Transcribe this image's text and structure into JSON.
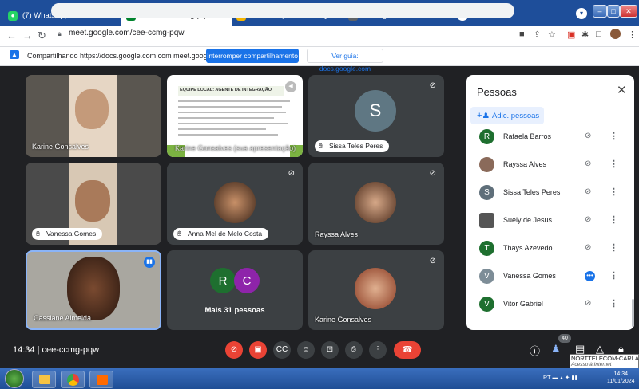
{
  "browser": {
    "tabs": [
      {
        "label": "(7) WhatsApp",
        "icon": "whatsapp-icon",
        "color": "#25d366",
        "close": "✕"
      },
      {
        "label": "Meet: cee-ccmg-pqw",
        "icon": "meet-icon",
        "color": "#00832d",
        "close": "✕",
        "active": true
      },
      {
        "label": "ATRIBUIÇÕES DE EQUIPE_CI",
        "icon": "slides-icon",
        "color": "#f4b400",
        "close": "✕"
      },
      {
        "label": "Nova guia",
        "icon": "chrome-icon",
        "color": "#5f6368",
        "close": "✕"
      }
    ],
    "new_tab": "+",
    "url": "meet.google.com/cee-ccmg-pqw"
  },
  "share_bar": {
    "text": "Compartilhando https://docs.google.com com meet.google.com",
    "stop_label": "Interromper compartilhamento",
    "guide_label": "Ver guia: docs.google.com"
  },
  "tiles": [
    {
      "name": "Karine Gonsalves"
    },
    {
      "name": "Karine Gonsalves (sua apresentação)",
      "slide_title": "EQUIPE LOCAL: AGENTE DE INTEGRAÇÃO"
    },
    {
      "name": "Sissa Teles Peres",
      "initial": "S"
    },
    {
      "name": "Vanessa Gomes"
    },
    {
      "name": "Anna Mel de Melo Costa"
    },
    {
      "name": "Rayssa Alves"
    },
    {
      "name": "Cassiane Almeida"
    },
    {
      "name": "Mais 31 pessoas",
      "initials": [
        "R",
        "C"
      ]
    },
    {
      "name": "Karine Gonsalves"
    }
  ],
  "people_panel": {
    "title": "Pessoas",
    "add_label": "Adic. pessoas",
    "people": [
      {
        "name": "Rafaela Barros",
        "initial": "R",
        "color": "#1e6f2f"
      },
      {
        "name": "Rayssa Alves",
        "initial": "",
        "color": "#8a6a5a"
      },
      {
        "name": "Sissa Teles Peres",
        "initial": "S",
        "color": "#5f6f7a"
      },
      {
        "name": "Suely de Jesus",
        "initial": "",
        "color": "#555"
      },
      {
        "name": "Thays Azevedo",
        "initial": "T",
        "color": "#1e6f2f"
      },
      {
        "name": "Vanessa Gomes",
        "initial": "V",
        "color": "#7d8d97"
      },
      {
        "name": "Vitor Gabriel",
        "initial": "V",
        "color": "#1e6f2f"
      }
    ]
  },
  "bottom": {
    "meeting_info": "14:34 | cee-ccmg-pqw",
    "participant_count": "40"
  },
  "tooltip": {
    "line1": "NORTTELECOM-CARLA-2G",
    "line2": "Acesso à Internet"
  },
  "taskbar": {
    "lang": "PT",
    "time": "14:34",
    "date": "11/01/2024"
  }
}
